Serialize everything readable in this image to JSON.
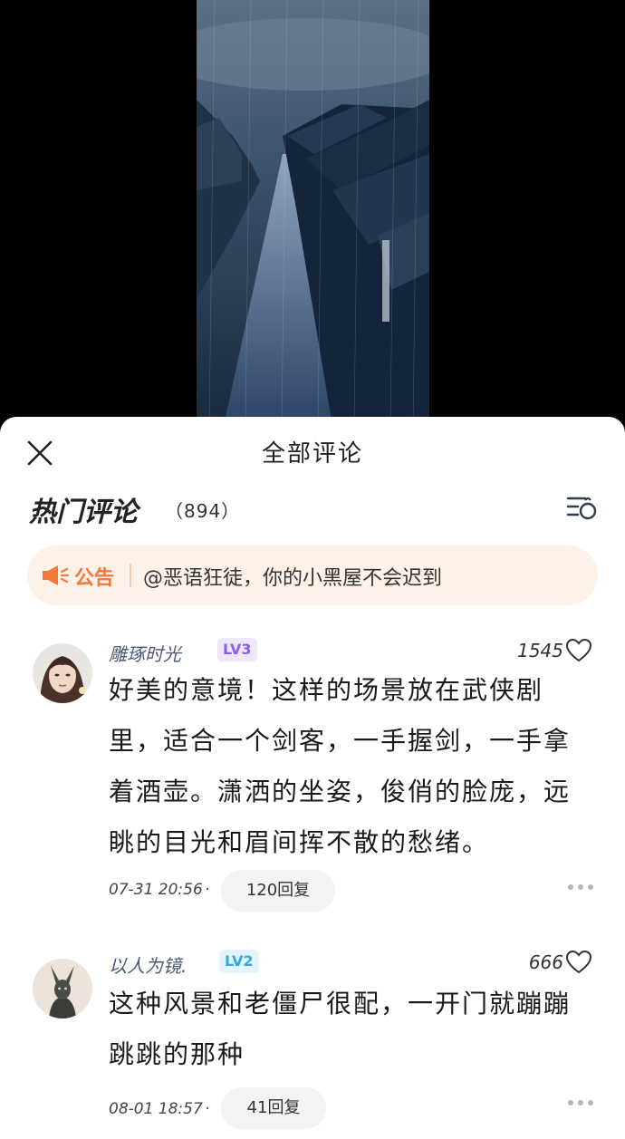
{
  "header": {
    "title": "全部评论"
  },
  "hot": {
    "title": "热门评论",
    "count": "（894）"
  },
  "notice": {
    "tag": "公告",
    "text": "@恶语狂徒，你的小黑屋不会迟到"
  },
  "comments": [
    {
      "username": "雕琢时光",
      "level": "LV3",
      "level_color": "#8a5cf0",
      "level_bg": "#efe8fd",
      "likes": "1545",
      "lines": [
        "好美的意境！这样的场景放在武侠剧",
        "里，适合一个剑客，一手握剑，一手拿",
        "着酒壶。潇洒的坐姿，俊俏的脸庞，远",
        "眺的目光和眉间挥不散的愁绪。"
      ],
      "time": "07-31 20:56",
      "dot": "·",
      "replies": "120回复"
    },
    {
      "username": "以人为镜.",
      "level": "LV2",
      "level_color": "#2aa8e8",
      "level_bg": "#e3f4fd",
      "likes": "666",
      "lines": [
        "这种风景和老僵尸很配，一开门就蹦蹦",
        "跳跳的那种"
      ],
      "time": "08-01 18:57",
      "dot": "·",
      "replies": "41回复"
    }
  ],
  "icons": {
    "close": "close-icon",
    "sort": "sort-icon",
    "notice": "megaphone-icon",
    "like": "heart-icon",
    "more": "more-icon"
  },
  "colors": {
    "notice_accent": "#f07a3a",
    "notice_bg": "#fdf1e8"
  }
}
